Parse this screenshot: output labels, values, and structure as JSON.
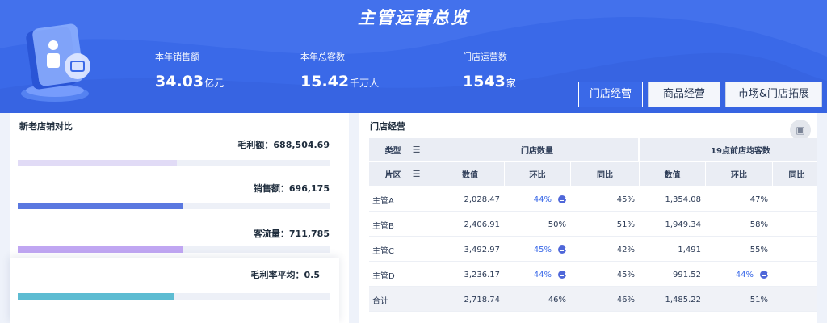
{
  "header": {
    "title": "主管运营总览",
    "stats": [
      {
        "label": "本年销售额",
        "value": "34.03",
        "unit": "亿元"
      },
      {
        "label": "本年总客数",
        "value": "15.42",
        "unit": "千万人"
      },
      {
        "label": "门店运营数",
        "value": "1543",
        "unit": "家"
      }
    ]
  },
  "tabs": [
    {
      "label": "门店经营",
      "active": true
    },
    {
      "label": "商品经营",
      "active": false
    },
    {
      "label": "市场&门店拓展",
      "active": false
    }
  ],
  "left_panel": {
    "title": "新老店铺对比",
    "metrics": [
      {
        "label": "毛利额：688,504.69",
        "fill": 0.51,
        "color": "#e1dbf6"
      },
      {
        "label": "销售额：696,175",
        "fill": 0.53,
        "color": "#5a78e0"
      },
      {
        "label": "客流量：711,785",
        "fill": 0.53,
        "color": "#c0a6f2"
      },
      {
        "label": "毛利率平均：0.5",
        "fill": 0.5,
        "color": "#5dbcd2"
      }
    ]
  },
  "right_panel": {
    "title": "门店经营",
    "settings_icon": "table-icon",
    "header_row1": {
      "type_label": "类型",
      "group1": "门店数量",
      "group2": "19点前店均客数"
    },
    "header_row2": {
      "area_label": "片区",
      "cols": [
        "数值",
        "环比",
        "同比",
        "数值",
        "环比",
        "同比"
      ]
    },
    "sort_icons": {
      "type": "sort-descending-icon",
      "area": "sort-ascending-icon"
    },
    "rows": [
      {
        "name": "主管A",
        "v1": "2,028.47",
        "h1": "44%",
        "h1_face": true,
        "t1": "45%",
        "v2": "1,354.08",
        "h2": "47%",
        "h2_face": false
      },
      {
        "name": "主管B",
        "v1": "2,406.91",
        "h1": "50%",
        "h1_face": false,
        "t1": "51%",
        "v2": "1,949.34",
        "h2": "58%",
        "h2_face": false
      },
      {
        "name": "主管C",
        "v1": "3,492.97",
        "h1": "45%",
        "h1_face": true,
        "t1": "42%",
        "v2": "1,491",
        "h2": "55%",
        "h2_face": false
      },
      {
        "name": "主管D",
        "v1": "3,236.17",
        "h1": "44%",
        "h1_face": true,
        "t1": "45%",
        "v2": "991.52",
        "h2": "44%",
        "h2_face": true
      },
      {
        "name": "合计",
        "v1": "2,718.74",
        "h1": "46%",
        "h1_face": false,
        "t1": "46%",
        "v2": "1,485.22",
        "h2": "51%",
        "h2_face": false
      }
    ],
    "face_icon": "neutral-face-icon"
  },
  "colors": {
    "header_bg": "#3a69e8",
    "accent": "#3a69e8"
  }
}
